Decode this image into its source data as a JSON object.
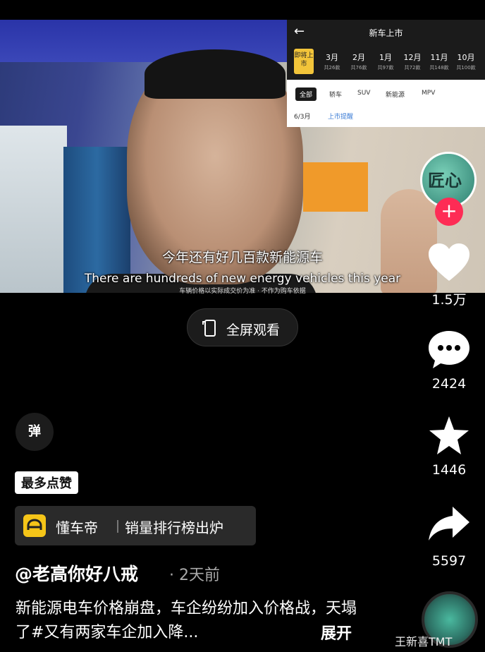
{
  "video": {
    "subtitle_cn": "今年还有好几百款新能源车",
    "subtitle_en": "There are hundreds of new energy vehicles this year",
    "subtitle_small": "车辆价格以实际成交价为准 · 不作为购车依据",
    "overlay": {
      "title": "新车上市",
      "badge": "即将上市",
      "months": [
        {
          "m": "3月",
          "c": "共26款"
        },
        {
          "m": "2月",
          "c": "共76款"
        },
        {
          "m": "1月",
          "c": "共97款"
        },
        {
          "m": "12月",
          "c": "共72款"
        },
        {
          "m": "11月",
          "c": "共148款"
        },
        {
          "m": "10月",
          "c": "共100款"
        }
      ],
      "tabs": [
        "全部",
        "轿车",
        "SUV",
        "新能源",
        "MPV"
      ],
      "date": "6/3月",
      "reminder": "上市提醒"
    }
  },
  "fullscreen_label": "全屏观看",
  "actions": {
    "likes": "1.5万",
    "comments": "2424",
    "favorites": "1446",
    "shares": "5597"
  },
  "avatar_text": "匠心",
  "danmu_label": "弹",
  "most_liked_tag": "最多点赞",
  "brand_tag": {
    "name": "懂车帝",
    "text": "销量排行榜出炉"
  },
  "author": "@老高你好八戒",
  "time": "· 2天前",
  "description": "新能源电车价格崩盘，车企纷纷加入价格战，天塌了#又有两家车企加入降...",
  "expand_label": "展开",
  "watermark": "王新喜TMT",
  "colors": {
    "accent_red": "#fe2c55",
    "brand_yellow": "#f5c518"
  }
}
